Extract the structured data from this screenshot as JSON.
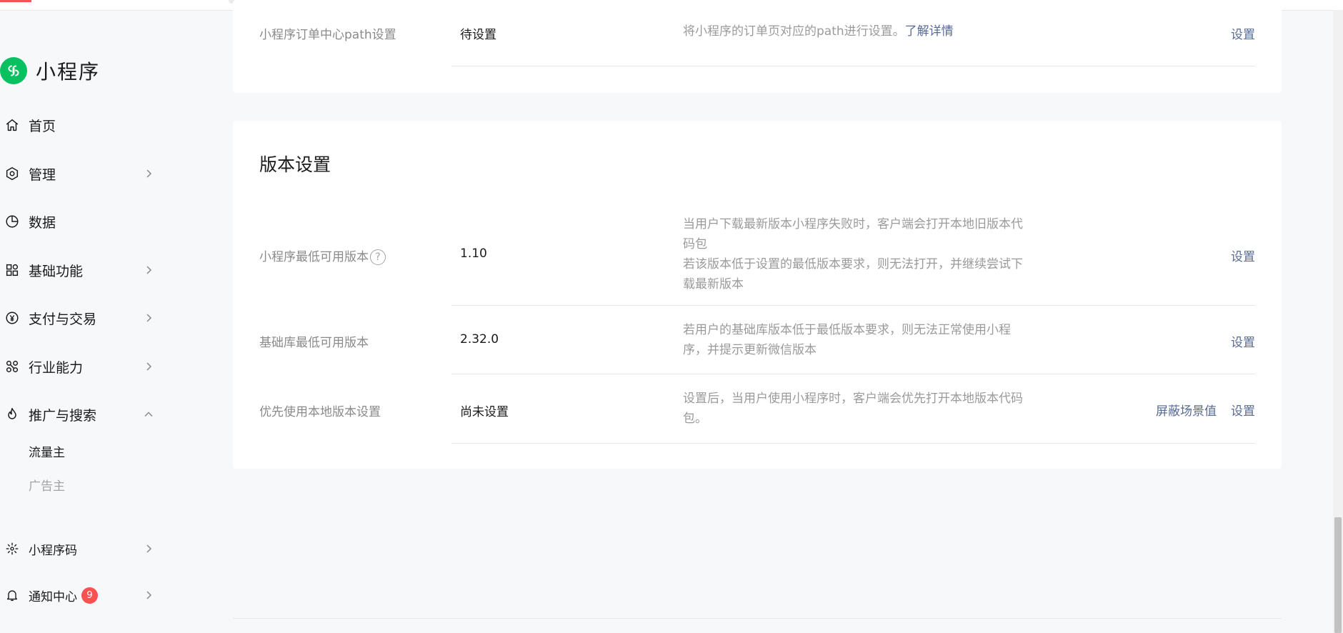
{
  "brand": {
    "name": "小程序"
  },
  "nav": [
    {
      "label": "首页",
      "icon": "home-icon",
      "chevron": "none"
    },
    {
      "label": "管理",
      "icon": "hexagon-icon",
      "chevron": "right"
    },
    {
      "label": "数据",
      "icon": "pie-chart-icon",
      "chevron": "none"
    },
    {
      "label": "基础功能",
      "icon": "grid-icon",
      "chevron": "right"
    },
    {
      "label": "支付与交易",
      "icon": "yen-icon",
      "chevron": "right"
    },
    {
      "label": "行业能力",
      "icon": "nodes-icon",
      "chevron": "right"
    },
    {
      "label": "推广与搜索",
      "icon": "flame-icon",
      "chevron": "up"
    }
  ],
  "sub_nav": [
    {
      "label": "流量主",
      "active": true
    },
    {
      "label": "广告主",
      "active": false
    }
  ],
  "nav_bottom": [
    {
      "label": "小程序码",
      "icon": "qrcode-burst-icon",
      "badge": ""
    },
    {
      "label": "通知中心",
      "icon": "bell-icon",
      "badge": "9"
    }
  ],
  "order_path_row": {
    "label": "小程序订单中心path设置",
    "value": "待设置",
    "desc": "将小程序的订单页对应的path进行设置。",
    "desc_link": "了解详情",
    "action": "设置"
  },
  "version_section": {
    "title": "版本设置",
    "rows": [
      {
        "label": "小程序最低可用版本",
        "value": "1.10",
        "desc_lines": [
          "当用户下载最新版本小程序失败时，客户端会打开本地旧版本代",
          "码包",
          "若该版本低于设置的最低版本要求，则无法打开，并继续尝试下",
          "载最新版本"
        ],
        "actions": [
          "设置"
        ]
      },
      {
        "label": "基础库最低可用版本",
        "value": "2.32.0",
        "desc_lines": [
          "若用户的基础库版本低于最低版本要求，则无法正常使用小程",
          "序，并提示更新微信版本"
        ],
        "actions": [
          "设置"
        ]
      },
      {
        "label": "优先使用本地版本设置",
        "value": "尚未设置",
        "desc_lines": [
          "设置后，当用户使用小程序时，客户端会优先打开本地版本代码",
          "包。"
        ],
        "actions": [
          "屏蔽场景值",
          "设置"
        ]
      }
    ]
  },
  "colors": {
    "accent": "#07c160",
    "link": "#576b95",
    "badge": "#fa5151"
  }
}
